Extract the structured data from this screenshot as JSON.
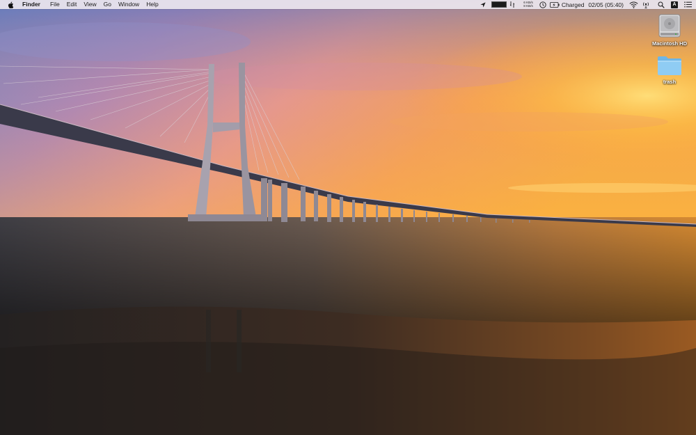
{
  "menubar": {
    "apple_icon": "apple-logo-icon",
    "app_name": "Finder",
    "menus": [
      "File",
      "Edit",
      "View",
      "Go",
      "Window",
      "Help"
    ],
    "status": {
      "net_up": "6 KB/s",
      "net_down": "8 KB/s",
      "battery_text": "Charged",
      "datetime": "02/05 (05:40)",
      "input_source": "A",
      "icons": [
        "location-arrow-icon",
        "activity-meter-icon",
        "sync-arrows-icon",
        "clock-icon",
        "battery-icon",
        "wifi-icon",
        "airdrop-icon",
        "spotlight-search-icon",
        "input-source-icon",
        "notification-center-icon"
      ]
    }
  },
  "desktop": {
    "wallpaper": "bridge-sunset-wallpaper",
    "icons": [
      {
        "label": "Macintosh HD",
        "icon": "hard-drive-icon"
      },
      {
        "label": "trash",
        "icon": "folder-icon"
      }
    ]
  }
}
